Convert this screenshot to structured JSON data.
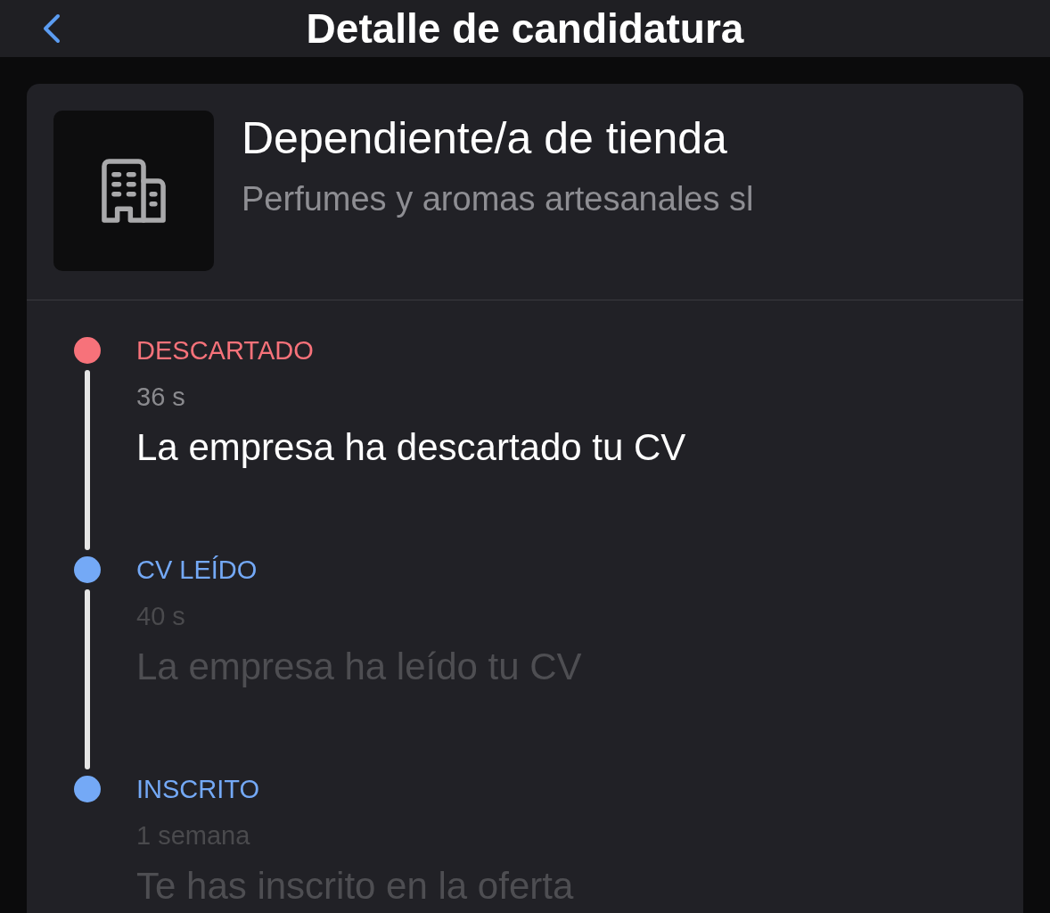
{
  "header": {
    "title": "Detalle de candidatura"
  },
  "job": {
    "title": "Dependiente/a de tienda",
    "company": "Perfumes y aromas artesanales sl"
  },
  "timeline": [
    {
      "status": "DESCARTADO",
      "color": "#f7727a",
      "time": "36 s",
      "message": "La empresa ha descartado tu CV",
      "current": true
    },
    {
      "status": "CV LEÍDO",
      "color": "#74a9f6",
      "time": "40 s",
      "message": "La empresa ha leído tu CV",
      "current": false
    },
    {
      "status": "INSCRITO",
      "color": "#74a9f6",
      "time": "1 semana",
      "message": "Te has inscrito en la oferta",
      "current": false
    }
  ]
}
